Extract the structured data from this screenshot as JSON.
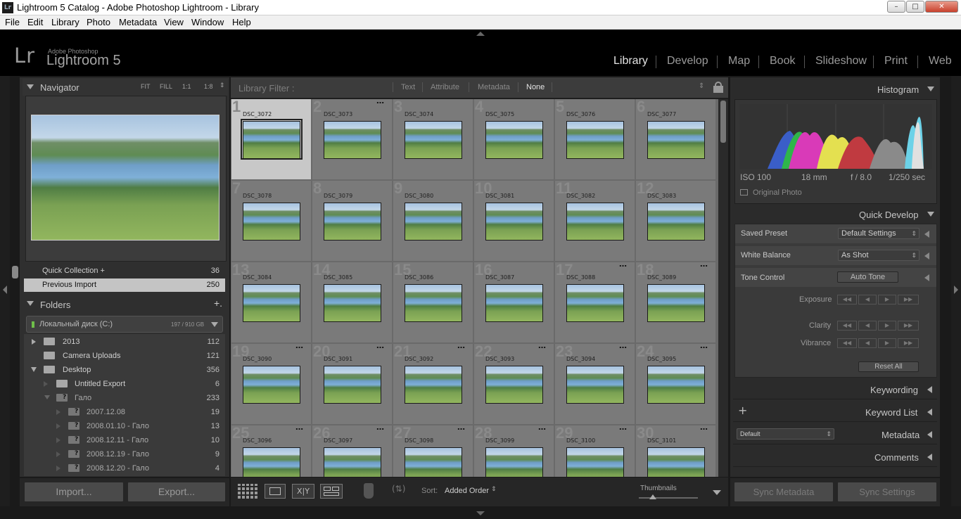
{
  "window": {
    "title": "Lightroom 5 Catalog - Adobe Photoshop Lightroom - Library",
    "app_icon": "Lr",
    "controls": [
      "minimize-icon",
      "maximize-icon",
      "close-icon"
    ]
  },
  "menu": [
    "File",
    "Edit",
    "Library",
    "Photo",
    "Metadata",
    "View",
    "Window",
    "Help"
  ],
  "identity": {
    "logo": "Lr",
    "vendor": "Adobe Photoshop",
    "product": "Lightroom 5",
    "modules": [
      "Library",
      "Develop",
      "Map",
      "Book",
      "Slideshow",
      "Print",
      "Web"
    ],
    "active_module": "Library"
  },
  "navigator": {
    "title": "Navigator",
    "zoom": [
      "FIT",
      "FILL",
      "1:1",
      "1:8"
    ]
  },
  "catalog": {
    "quick_collection": "Quick Collection +",
    "quick_collection_count": "36",
    "previous_import": "Previous Import",
    "previous_import_count": "250"
  },
  "folders": {
    "title": "Folders",
    "add": "+.",
    "volume": "Локальный диск (C:)",
    "volume_space": "197 / 910 GB",
    "rows": [
      {
        "name": "2013",
        "count": "112"
      },
      {
        "name": "Camera Uploads",
        "count": "121"
      },
      {
        "name": "Desktop",
        "count": "356"
      },
      {
        "name": "Untitled Export",
        "count": "6"
      },
      {
        "name": "Гало",
        "count": "233"
      },
      {
        "name": "2007.12.08",
        "count": "19"
      },
      {
        "name": "2008.01.10 - Гало",
        "count": "13"
      },
      {
        "name": "2008.12.11 - Гало",
        "count": "10"
      },
      {
        "name": "2008.12.19 - Гало",
        "count": "9"
      },
      {
        "name": "2008.12.20 - Гало",
        "count": "4"
      }
    ]
  },
  "left_buttons": {
    "import": "Import...",
    "export": "Export..."
  },
  "filter_bar": {
    "label": "Library Filter :",
    "options": [
      "Text",
      "Attribute",
      "Metadata",
      "None"
    ],
    "active": "None"
  },
  "grid": {
    "cells": [
      {
        "num": "1",
        "file": "DSC_3072"
      },
      {
        "num": "2",
        "file": "DSC_3073"
      },
      {
        "num": "3",
        "file": "DSC_3074"
      },
      {
        "num": "4",
        "file": "DSC_3075"
      },
      {
        "num": "5",
        "file": "DSC_3076"
      },
      {
        "num": "6",
        "file": "DSC_3077"
      },
      {
        "num": "7",
        "file": "DSC_3078"
      },
      {
        "num": "8",
        "file": "DSC_3079"
      },
      {
        "num": "9",
        "file": "DSC_3080"
      },
      {
        "num": "10",
        "file": "DSC_3081"
      },
      {
        "num": "11",
        "file": "DSC_3082"
      },
      {
        "num": "12",
        "file": "DSC_3083"
      },
      {
        "num": "13",
        "file": "DSC_3084"
      },
      {
        "num": "14",
        "file": "DSC_3085"
      },
      {
        "num": "15",
        "file": "DSC_3086"
      },
      {
        "num": "16",
        "file": "DSC_3087"
      },
      {
        "num": "17",
        "file": "DSC_3088"
      },
      {
        "num": "18",
        "file": "DSC_3089"
      },
      {
        "num": "19",
        "file": "DSC_3090"
      },
      {
        "num": "20",
        "file": "DSC_3091"
      },
      {
        "num": "21",
        "file": "DSC_3092"
      },
      {
        "num": "22",
        "file": "DSC_3093"
      },
      {
        "num": "23",
        "file": "DSC_3094"
      },
      {
        "num": "24",
        "file": "DSC_3095"
      },
      {
        "num": "25",
        "file": "DSC_3096"
      },
      {
        "num": "26",
        "file": "DSC_3097"
      },
      {
        "num": "27",
        "file": "DSC_3098"
      },
      {
        "num": "28",
        "file": "DSC_3099"
      },
      {
        "num": "29",
        "file": "DSC_3100"
      },
      {
        "num": "30",
        "file": "DSC_3101"
      }
    ],
    "selected_index": 0,
    "dots_on": [
      1,
      16,
      17,
      18,
      19,
      20,
      21,
      22,
      23,
      24,
      25,
      26,
      27,
      28,
      29
    ]
  },
  "toolbar": {
    "sort_label": "Sort:",
    "sort_value": "Added Order",
    "thumbnails_label": "Thumbnails"
  },
  "histogram": {
    "title": "Histogram",
    "iso": "ISO 100",
    "focal": "18 mm",
    "aperture": "f / 8.0",
    "shutter": "1/250 sec",
    "original": "Original Photo"
  },
  "quick_develop": {
    "title": "Quick Develop",
    "saved_preset_label": "Saved Preset",
    "saved_preset_value": "Default Settings",
    "white_balance_label": "White Balance",
    "white_balance_value": "As Shot",
    "tone_control_label": "Tone Control",
    "auto_tone": "Auto Tone",
    "exposure": "Exposure",
    "clarity": "Clarity",
    "vibrance": "Vibrance",
    "reset_all": "Reset All"
  },
  "right_panels": {
    "keywording": "Keywording",
    "keyword_list": "Keyword List",
    "metadata": "Metadata",
    "metadata_preset": "Default",
    "comments": "Comments"
  },
  "right_buttons": {
    "sync_metadata": "Sync Metadata",
    "sync_settings": "Sync Settings"
  },
  "colors": {
    "background": "#1a1a1a",
    "panel": "#2f2f2f",
    "grid_cell": "#7a7a7a",
    "selected_cell": "#c8c8c8"
  }
}
